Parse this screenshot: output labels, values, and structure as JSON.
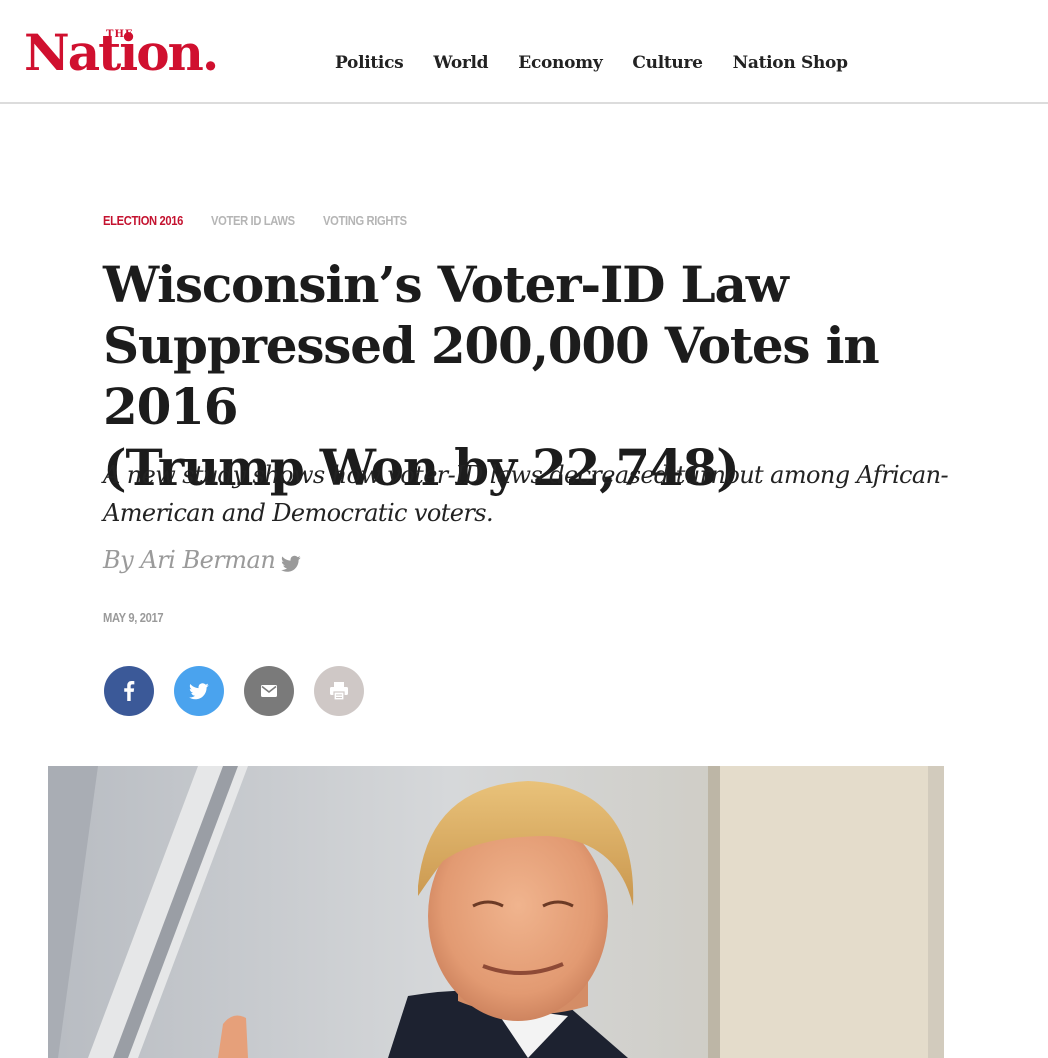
{
  "header": {
    "logo_small": "THE",
    "logo_main": "Nation.",
    "nav": [
      "Politics",
      "World",
      "Economy",
      "Culture",
      "Nation Shop"
    ]
  },
  "article": {
    "tags": [
      {
        "label": "Election 2016",
        "style": "primary"
      },
      {
        "label": "Voter ID Laws",
        "style": "secondary"
      },
      {
        "label": "Voting Rights",
        "style": "secondary"
      }
    ],
    "title_lines": [
      "Wisconsin’s Voter-ID Law",
      "Suppressed 200,000 Votes in 2016",
      "(Trump Won by 22,748)"
    ],
    "subtitle_lines": [
      "A new study shows how voter-ID laws decreased turnout among African-",
      "American and Democratic voters."
    ],
    "byline_prefix": "By",
    "author": "Ari Berman",
    "date": "May 9, 2017"
  },
  "share": [
    {
      "network": "facebook",
      "icon": "facebook-icon"
    },
    {
      "network": "twitter",
      "icon": "twitter-icon"
    },
    {
      "network": "email",
      "icon": "mail-icon"
    },
    {
      "network": "print",
      "icon": "printer-icon"
    }
  ],
  "colors": {
    "brand_red": "#d0102f",
    "facebook": "#3b5998",
    "twitter": "#4aa3ee",
    "email": "#7a7a7a",
    "print": "#cfc8c6",
    "muted_text": "#9a9a9a"
  }
}
